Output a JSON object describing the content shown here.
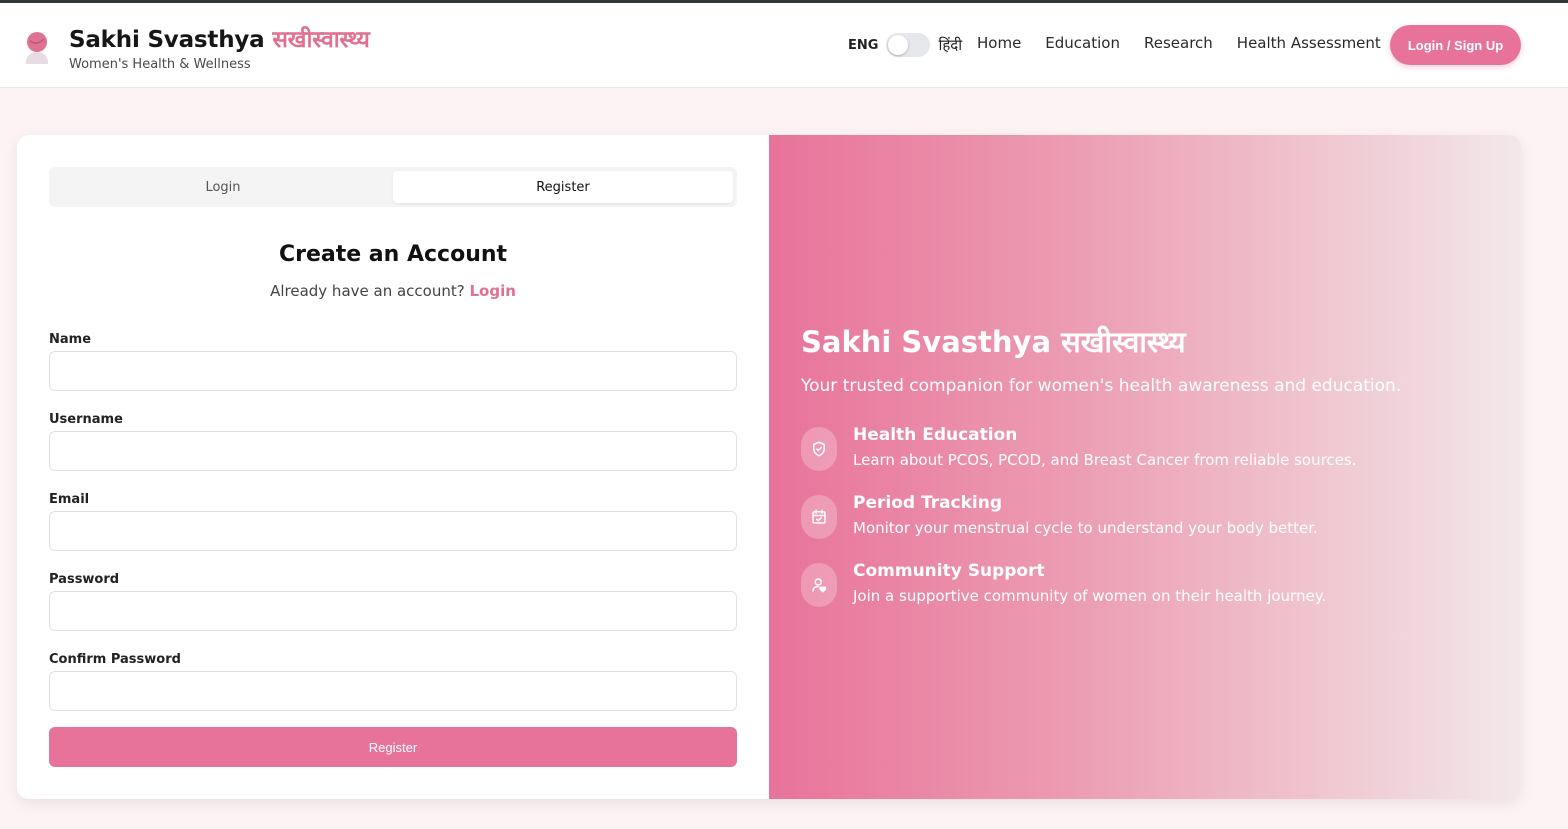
{
  "header": {
    "brand_title": "Sakhi Svasthya",
    "brand_title_hi": "सखीस्वास्थ्य",
    "brand_subtitle": "Women's Health & Wellness",
    "lang_eng": "ENG",
    "lang_hi": "हिंदी",
    "nav": [
      "Home",
      "Education",
      "Research",
      "Health Assessment"
    ],
    "login_button": "Login / Sign Up"
  },
  "auth": {
    "tabs": [
      "Login",
      "Register"
    ],
    "active_tab": "Register",
    "title": "Create an Account",
    "subtitle_text": "Already have an account?",
    "subtitle_link": "Login",
    "fields": [
      {
        "label": "Name",
        "value": ""
      },
      {
        "label": "Username",
        "value": ""
      },
      {
        "label": "Email",
        "value": ""
      },
      {
        "label": "Password",
        "value": ""
      },
      {
        "label": "Confirm Password",
        "value": ""
      }
    ],
    "submit_label": "Register"
  },
  "promo": {
    "title": "Sakhi Svasthya सखीस्वास्थ्य",
    "subtitle": "Your trusted companion for women's health awareness and education.",
    "features": [
      {
        "icon": "shield-check-icon",
        "title": "Health Education",
        "desc": "Learn about PCOS, PCOD, and Breast Cancer from reliable sources."
      },
      {
        "icon": "calendar-check-icon",
        "title": "Period Tracking",
        "desc": "Monitor your menstrual cycle to understand your body better."
      },
      {
        "icon": "user-heart-icon",
        "title": "Community Support",
        "desc": "Join a supportive community of women on their health journey."
      }
    ]
  },
  "colors": {
    "accent": "#e8739a",
    "brand_hi": "#e0718f"
  }
}
